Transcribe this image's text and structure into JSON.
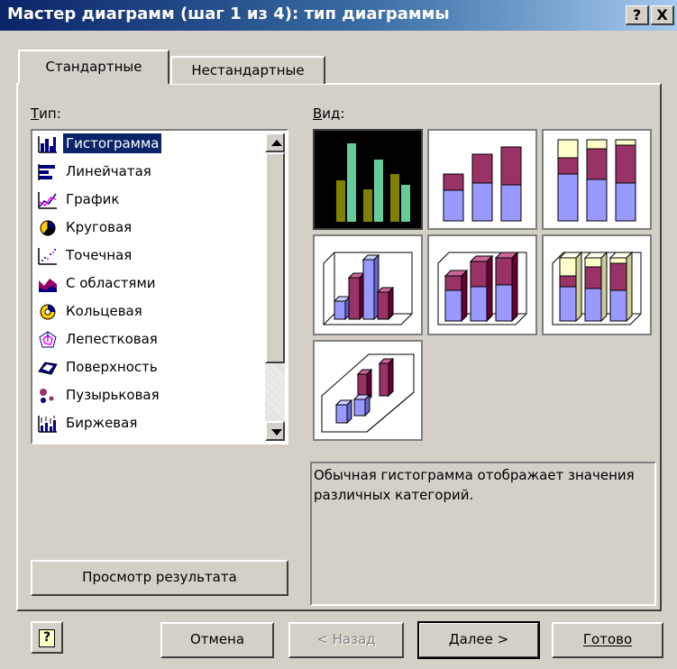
{
  "window": {
    "title": "Мастер диаграмм (шаг 1 из 4): тип диаграммы",
    "help_button": "?",
    "close_button": "X"
  },
  "tabs": [
    {
      "label": "Стандартные",
      "active": true
    },
    {
      "label": "Нестандартные",
      "active": false
    }
  ],
  "type_section": {
    "label": "Тип:",
    "items": [
      {
        "label": "Гистограмма",
        "icon": "column-chart-icon",
        "selected": true
      },
      {
        "label": "Линейчатая",
        "icon": "bar-chart-icon"
      },
      {
        "label": "График",
        "icon": "line-chart-icon"
      },
      {
        "label": "Круговая",
        "icon": "pie-chart-icon"
      },
      {
        "label": "Точечная",
        "icon": "scatter-chart-icon"
      },
      {
        "label": "С областями",
        "icon": "area-chart-icon"
      },
      {
        "label": "Кольцевая",
        "icon": "doughnut-chart-icon"
      },
      {
        "label": "Лепестковая",
        "icon": "radar-chart-icon"
      },
      {
        "label": "Поверхность",
        "icon": "surface-chart-icon"
      },
      {
        "label": "Пузырьковая",
        "icon": "bubble-chart-icon"
      },
      {
        "label": "Биржевая",
        "icon": "stock-chart-icon"
      }
    ]
  },
  "view_section": {
    "label": "Вид:",
    "subtypes": [
      {
        "name": "clustered-column",
        "selected": true
      },
      {
        "name": "stacked-column"
      },
      {
        "name": "100-percent-stacked-column"
      },
      {
        "name": "3d-clustered-column"
      },
      {
        "name": "3d-stacked-column"
      },
      {
        "name": "3d-100-percent-stacked-column"
      },
      {
        "name": "3d-column"
      }
    ]
  },
  "description": "Обычная гистограмма отображает значения различных категорий.",
  "preview_button": "Просмотр результата",
  "buttons": {
    "help": "?",
    "cancel": "Отмена",
    "back": "< Назад",
    "next": "Далее >",
    "finish": "Готово"
  },
  "colors": {
    "title_bar": "#0a246a",
    "dialog_bg": "#d4d0c8",
    "selection": "#0a246a",
    "series_blue": "#9999ff",
    "series_plum": "#993366",
    "series_cream": "#ffffcc",
    "selected_bar_olive": "#808000",
    "selected_bar_teal": "#66cc99"
  }
}
